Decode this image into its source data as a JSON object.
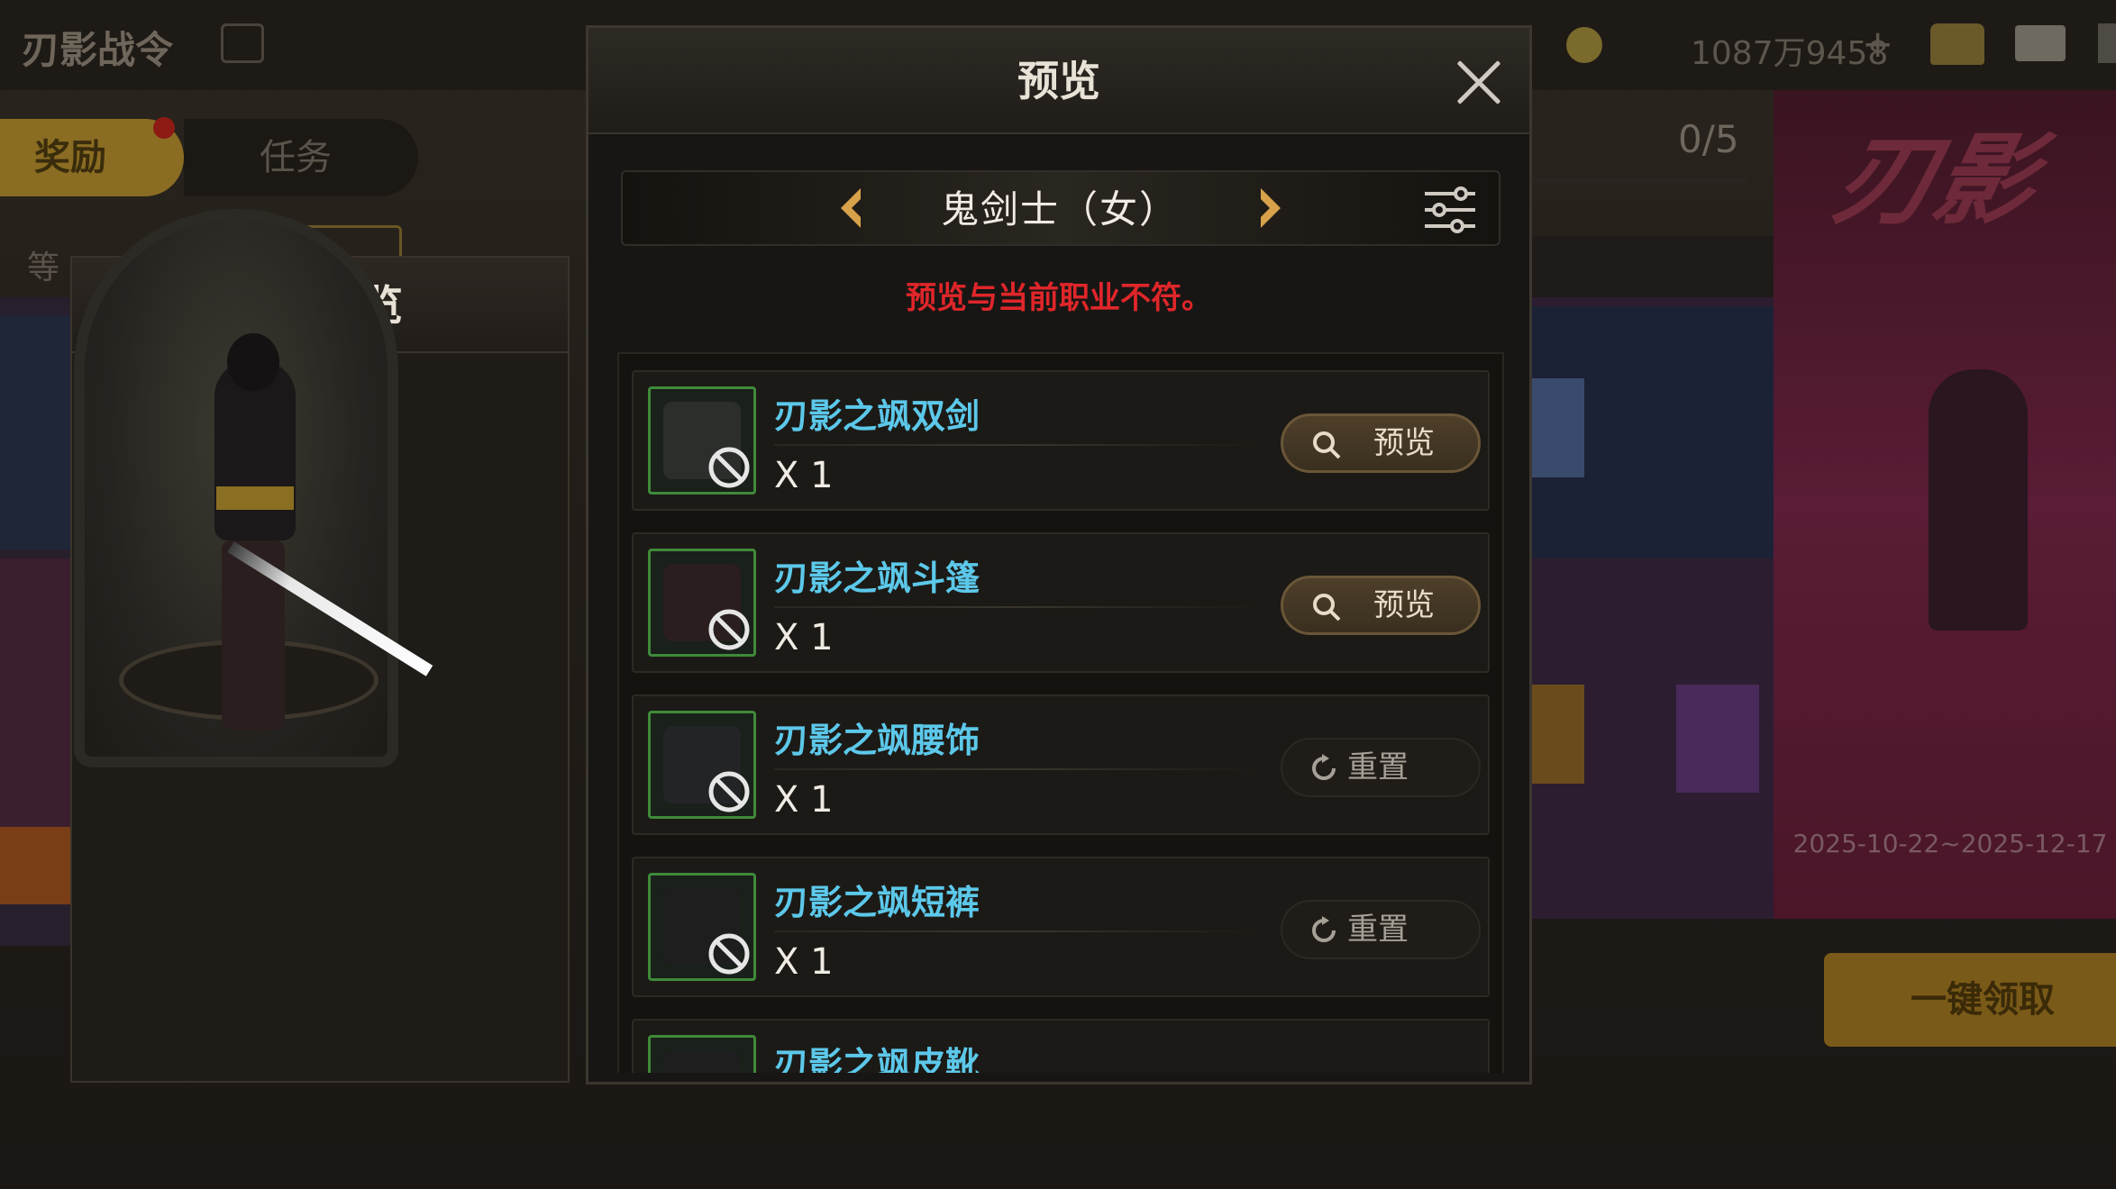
{
  "background": {
    "title": "刃影战令",
    "currency": "1087万9458",
    "plus": "+",
    "tabs": [
      {
        "label": "奖励",
        "active": true
      },
      {
        "label": "任务",
        "active": false
      }
    ],
    "sub_label": "等",
    "counter": "0/5",
    "event_date": "2025-10-22~2025-12-17",
    "claim_button": "一键领取"
  },
  "outfit_panel": {
    "title": "装扮预览"
  },
  "dialog": {
    "title": "预览",
    "class_name": "鬼剑士（女）",
    "warning": "预览与当前职业不符。",
    "items": [
      {
        "name": "刃影之飒双剑",
        "qty": "X 1",
        "action": "预览",
        "action_type": "preview",
        "icon": "dual-blade-icon"
      },
      {
        "name": "刃影之飒斗篷",
        "qty": "X 1",
        "action": "预览",
        "action_type": "preview",
        "icon": "cloak-icon"
      },
      {
        "name": "刃影之飒腰饰",
        "qty": "X 1",
        "action": "重置",
        "action_type": "reset",
        "icon": "belt-icon"
      },
      {
        "name": "刃影之飒短裤",
        "qty": "X 1",
        "action": "重置",
        "action_type": "reset",
        "icon": "shorts-icon"
      },
      {
        "name": "刃影之飒皮靴",
        "qty": "",
        "action": "",
        "action_type": "reset",
        "icon": "boots-icon"
      }
    ]
  },
  "colors": {
    "item_name": "#5cc8ea",
    "warning": "#e0262a",
    "icon_border": "#3f8a3a",
    "accent_gold": "#8a6d22"
  }
}
